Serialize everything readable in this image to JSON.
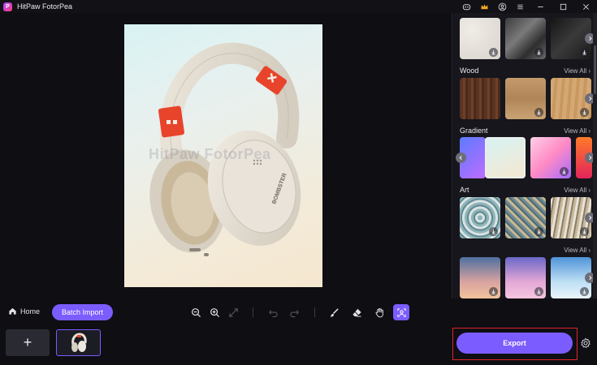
{
  "app": {
    "title": "HitPaw FotorPea",
    "logo_letter": "P"
  },
  "titlebar_icons": [
    "discord-icon",
    "crown-icon",
    "account-icon",
    "menu-icon",
    "minimize-icon",
    "maximize-icon",
    "close-icon"
  ],
  "canvas": {
    "watermark": "HitPaw FotorPea",
    "product_brand": "BOMBSTER"
  },
  "panel": {
    "sections": [
      {
        "name": "",
        "view_all": "",
        "thumbs": [
          "plaster",
          "marble",
          "dark-stone"
        ]
      },
      {
        "name": "Wood",
        "view_all": "View All",
        "thumbs": [
          "dark-wood",
          "light-wood",
          "oak-wood"
        ]
      },
      {
        "name": "Gradient",
        "view_all": "View All",
        "thumbs": [
          "mint-peach",
          "pink-violet",
          "orange-red"
        ]
      },
      {
        "name": "Art",
        "view_all": "View All",
        "thumbs": [
          "blue-pattern",
          "mosaic",
          "abstract-strokes"
        ]
      },
      {
        "name": "",
        "view_all": "View All",
        "thumbs": [
          "sunset-sky",
          "pink-clouds",
          "blue-sky"
        ]
      }
    ]
  },
  "toolbar": {
    "home_label": "Home",
    "batch_label": "Batch Import",
    "tools": [
      "zoom-out-icon",
      "zoom-in-icon",
      "fit-screen-icon",
      "undo-icon",
      "redo-icon",
      "brush-icon",
      "eraser-icon",
      "hand-icon",
      "compare-icon"
    ]
  },
  "bottom": {
    "add_label": "+",
    "export_label": "Export"
  },
  "colors": {
    "accent": "#7b5cff",
    "highlight": "#e0262b",
    "background": "#0e0e13"
  }
}
